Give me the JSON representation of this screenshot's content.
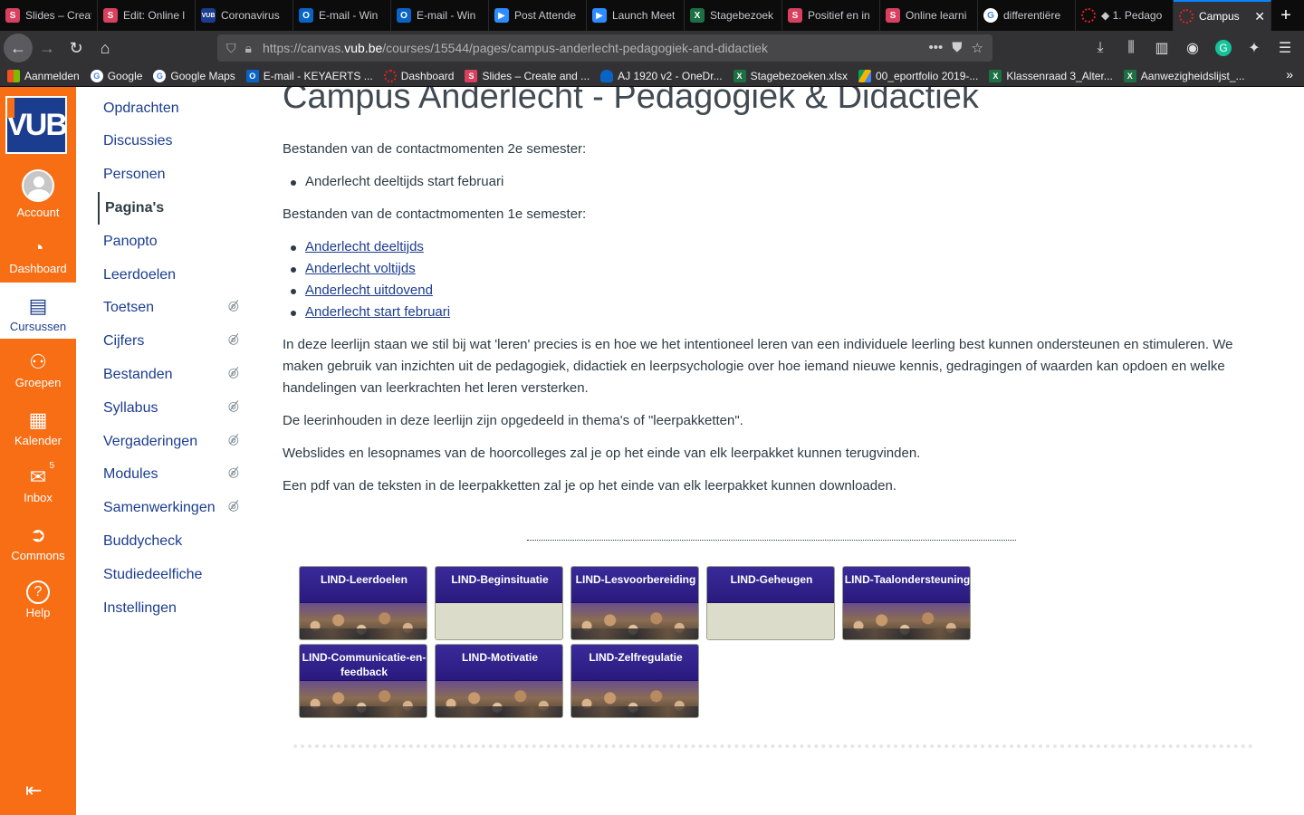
{
  "browser": {
    "tabs": [
      {
        "label": "Slides – Create",
        "icon": "slides-icon",
        "color": "#d9405e"
      },
      {
        "label": "Edit: Online l",
        "icon": "slides-icon",
        "color": "#d9405e"
      },
      {
        "label": "Coronavirus",
        "icon": "vub-icon",
        "color": "#1b3d8f"
      },
      {
        "label": "E-mail - Win",
        "icon": "outlook-icon",
        "color": "#0a64c8"
      },
      {
        "label": "E-mail - Win",
        "icon": "outlook-icon",
        "color": "#0a64c8"
      },
      {
        "label": "Post Attende",
        "icon": "zoom-icon",
        "color": "#2d8cff"
      },
      {
        "label": "Launch Meet",
        "icon": "zoom-icon",
        "color": "#2d8cff"
      },
      {
        "label": "Stagebezoek",
        "icon": "excel-icon",
        "color": "#1d7044"
      },
      {
        "label": "Positief en in",
        "icon": "slides-icon",
        "color": "#d9405e"
      },
      {
        "label": "Online learni",
        "icon": "slides-icon",
        "color": "#d9405e"
      },
      {
        "label": "differentiëre",
        "icon": "google-icon",
        "color": "#ffffff"
      },
      {
        "label": "◆ 1. Pedago",
        "icon": "canvas-icon",
        "color": "#e02020"
      },
      {
        "label": "Campus",
        "icon": "canvas-icon",
        "color": "#e02020"
      }
    ],
    "url_prefix": "https://canvas.",
    "url_host": "vub.be",
    "url_path": "/courses/15544/pages/campus-anderlecht-pedagogiek-and-didactiek",
    "bookmarks": [
      {
        "label": "Aanmelden",
        "icon": "microsoft-icon",
        "color": "#f25022"
      },
      {
        "label": "Google",
        "icon": "google-icon",
        "color": "#ffffff"
      },
      {
        "label": "Google Maps",
        "icon": "google-icon",
        "color": "#ffffff"
      },
      {
        "label": "E-mail - KEYAERTS ...",
        "icon": "outlook-icon",
        "color": "#0a64c8"
      },
      {
        "label": "Dashboard",
        "icon": "canvas-icon",
        "color": "#e02020"
      },
      {
        "label": "Slides – Create and ...",
        "icon": "slides-icon",
        "color": "#d9405e"
      },
      {
        "label": "AJ 1920 v2 - OneDr...",
        "icon": "onedrive-icon",
        "color": "#0a64c8"
      },
      {
        "label": "Stagebezoeken.xlsx",
        "icon": "excel-icon",
        "color": "#1d7044"
      },
      {
        "label": "00_eportfolio 2019-...",
        "icon": "drive-icon",
        "color": "#f4b400"
      },
      {
        "label": "Klassenraad 3_Alter...",
        "icon": "excel-icon",
        "color": "#1d7044"
      },
      {
        "label": "Aanwezigheidslijst_...",
        "icon": "excel-icon",
        "color": "#1d7044"
      }
    ]
  },
  "global_nav": {
    "logo": "VUB",
    "items": [
      {
        "label": "Account",
        "icon": "avatar-icon"
      },
      {
        "label": "Dashboard",
        "icon": "dashboard-icon"
      },
      {
        "label": "Cursussen",
        "icon": "courses-icon"
      },
      {
        "label": "Groepen",
        "icon": "groups-icon"
      },
      {
        "label": "Kalender",
        "icon": "calendar-icon"
      },
      {
        "label": "Inbox",
        "icon": "inbox-icon",
        "badge": "5"
      },
      {
        "label": "Commons",
        "icon": "commons-icon"
      },
      {
        "label": "Help",
        "icon": "help-icon"
      }
    ],
    "active": "Cursussen",
    "accent": "#f76e14"
  },
  "course_nav": {
    "items": [
      {
        "label": "Opdrachten",
        "hidden": false
      },
      {
        "label": "Discussies",
        "hidden": false
      },
      {
        "label": "Personen",
        "hidden": false
      },
      {
        "label": "Pagina's",
        "hidden": false,
        "active": true
      },
      {
        "label": "Panopto",
        "hidden": false
      },
      {
        "label": "Leerdoelen",
        "hidden": false
      },
      {
        "label": "Toetsen",
        "hidden": true
      },
      {
        "label": "Cijfers",
        "hidden": true
      },
      {
        "label": "Bestanden",
        "hidden": true
      },
      {
        "label": "Syllabus",
        "hidden": true
      },
      {
        "label": "Vergaderingen",
        "hidden": true
      },
      {
        "label": "Modules",
        "hidden": true
      },
      {
        "label": "Samenwerkingen",
        "hidden": true
      },
      {
        "label": "Buddycheck",
        "hidden": false
      },
      {
        "label": "Studiedeelfiche",
        "hidden": false
      },
      {
        "label": "Instellingen",
        "hidden": false
      }
    ]
  },
  "page": {
    "title": "Campus Anderlecht - Pedagogiek & Didactiek",
    "sem2_heading": "Bestanden van de contactmomenten 2e semester:",
    "sem2_items": [
      "Anderlecht deeltijds start februari"
    ],
    "sem1_heading": "Bestanden van de contactmomenten 1e semester:",
    "sem1_links": [
      "Anderlecht deeltijds",
      "Anderlecht voltijds",
      "Anderlecht uitdovend",
      "Anderlecht start februari"
    ],
    "intro": "In deze leerlijn staan we stil bij wat 'leren' precies is en hoe we het intentioneel leren van een individuele leerling best kunnen ondersteunen en stimuleren. We maken gebruik van inzichten uit de pedagogiek, didactiek en leerpsychologie over hoe iemand nieuwe kennis, gedragingen of waarden kan opdoen en welke handelingen van leerkrachten het leren versterken.",
    "themes": "De leerinhouden in deze leerlijn zijn opgedeeld in thema's of \"leerpakketten\".",
    "webslides": "Webslides en lesopnames van de hoorcolleges zal je op het einde van elk leerpakket kunnen terugvinden.",
    "pdf": "Een pdf van de teksten in de leerpakketten zal je op het einde van elk leerpakket kunnen downloaden.",
    "tiles": [
      {
        "label": "LIND-Leerdoelen",
        "image": true
      },
      {
        "label": "LIND-Beginsituatie",
        "image": false
      },
      {
        "label": "LIND-Lesvoorbereiding",
        "image": true
      },
      {
        "label": "LIND-Geheugen",
        "image": false
      },
      {
        "label": "LIND-Taalondersteuning",
        "image": true
      },
      {
        "label": "LIND-Communicatie-en-feedback",
        "image": true
      },
      {
        "label": "LIND-Motivatie",
        "image": true
      },
      {
        "label": "LIND-Zelfregulatie",
        "image": true
      }
    ]
  }
}
